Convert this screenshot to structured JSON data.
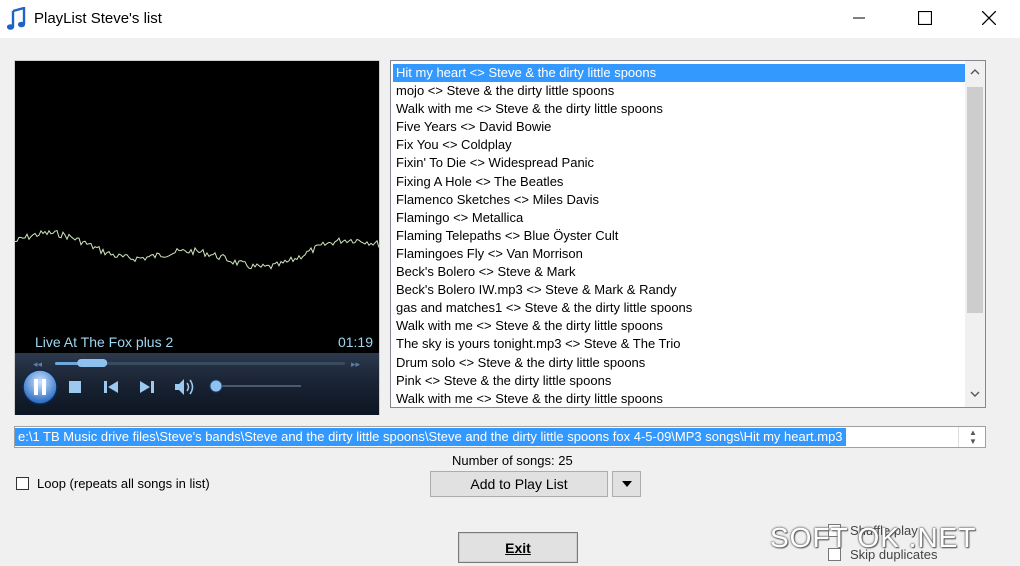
{
  "window": {
    "title": "PlayList Steve's list",
    "icon": "music-note-icon"
  },
  "player": {
    "media_name": "Live At The Fox plus 2",
    "time": "01:19",
    "seek_progress": 0.18,
    "volume_level": 0.0,
    "controls": [
      "pause-icon",
      "stop-icon",
      "previous-icon",
      "next-icon",
      "volume-icon"
    ]
  },
  "playlist": {
    "selected_index": 0,
    "items": [
      "Hit my heart <> Steve & the dirty little spoons",
      "mojo <> Steve & the dirty little spoons",
      "Walk with me <> Steve & the dirty little spoons",
      "Five Years <> David Bowie",
      "Fix You <> Coldplay",
      "Fixin' To Die <> Widespread Panic",
      "Fixing A Hole <> The Beatles",
      "Flamenco Sketches <> Miles Davis",
      "Flamingo <> Metallica",
      "Flaming Telepaths <> Blue Öyster Cult",
      "Flamingoes Fly <> Van Morrison",
      "Beck's Bolero <> Steve & Mark",
      "Beck's Bolero IW.mp3 <> Steve & Mark & Randy",
      "gas and matches1 <> Steve & the dirty little spoons",
      "Walk with me <> Steve & the dirty little spoons",
      "The sky is yours tonight.mp3 <> Steve & The Trio",
      "Drum solo <> Steve & the dirty little spoons",
      "Pink <> Steve & the dirty little spoons",
      "Walk with me <> Steve & the dirty little spoons"
    ]
  },
  "path": {
    "value": "e:\\1 TB Music drive files\\Steve's bands\\Steve and the dirty little spoons\\Steve and the dirty little spoons fox 4-5-09\\MP3 songs\\Hit my heart.mp3"
  },
  "song_count_label": "Number of songs: 25",
  "loop": {
    "label": "Loop (repeats all songs in list)",
    "checked": false
  },
  "buttons": {
    "add": "Add to Play List",
    "exit": "Exit"
  },
  "options": {
    "shuffle": {
      "label": "Shuffle play",
      "checked": false
    },
    "skip": {
      "label": "Skip duplicates",
      "checked": false
    }
  },
  "watermark": "SOFT OK .NET",
  "colors": {
    "selection": "#3399ff",
    "media_text": "#9fd6f2",
    "wave": "#cfe8c0"
  }
}
